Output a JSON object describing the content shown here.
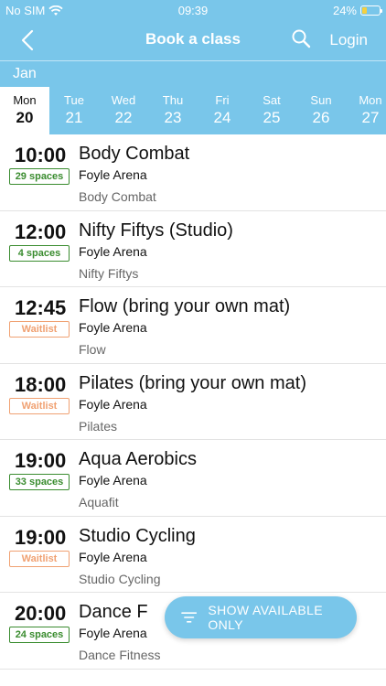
{
  "status": {
    "carrier": "No SIM",
    "time": "09:39",
    "battery": "24%"
  },
  "nav": {
    "title": "Book a class",
    "login": "Login"
  },
  "calendar": {
    "month": "Jan",
    "days": [
      {
        "wd": "Mon",
        "dn": "20"
      },
      {
        "wd": "Tue",
        "dn": "21"
      },
      {
        "wd": "Wed",
        "dn": "22"
      },
      {
        "wd": "Thu",
        "dn": "23"
      },
      {
        "wd": "Fri",
        "dn": "24"
      },
      {
        "wd": "Sat",
        "dn": "25"
      },
      {
        "wd": "Sun",
        "dn": "26"
      },
      {
        "wd": "Mon",
        "dn": "27"
      }
    ]
  },
  "classes": [
    {
      "time": "10:00",
      "badge": "29 spaces",
      "title": "Body Combat",
      "venue": "Foyle Arena",
      "category": "Body Combat"
    },
    {
      "time": "12:00",
      "badge": "4 spaces",
      "title": "Nifty Fiftys (Studio)",
      "venue": "Foyle Arena",
      "category": "Nifty Fiftys"
    },
    {
      "time": "12:45",
      "badge": "Waitlist",
      "title": "Flow (bring your own mat)",
      "venue": "Foyle Arena",
      "category": "Flow"
    },
    {
      "time": "18:00",
      "badge": "Waitlist",
      "title": "Pilates (bring your own mat)",
      "venue": "Foyle Arena",
      "category": "Pilates"
    },
    {
      "time": "19:00",
      "badge": "33 spaces",
      "title": "Aqua Aerobics",
      "venue": "Foyle Arena",
      "category": "Aquafit"
    },
    {
      "time": "19:00",
      "badge": "Waitlist",
      "title": "Studio Cycling",
      "venue": "Foyle Arena",
      "category": "Studio Cycling"
    },
    {
      "time": "20:00",
      "badge": "24 spaces",
      "title": "Dance F",
      "venue": "Foyle Arena",
      "category": "Dance Fitness"
    }
  ],
  "fab": {
    "label": "SHOW AVAILABLE ONLY"
  },
  "colors": {
    "header": "#79c6ea",
    "spaces": "#3a8c2f",
    "waitlist": "#f0a172"
  }
}
